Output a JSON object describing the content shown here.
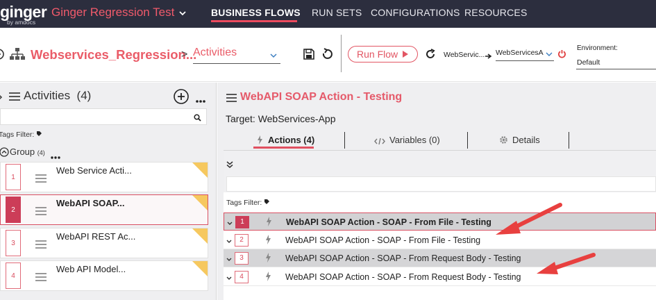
{
  "brand": {
    "logo": "ginger",
    "logo_sub": "by amdocs"
  },
  "app": {
    "solution_name": "Ginger Regression Test"
  },
  "nav": {
    "items": [
      "BUSINESS FLOWS",
      "RUN SETS",
      "CONFIGURATIONS",
      "RESOURCES"
    ],
    "active": "BUSINESS FLOWS"
  },
  "toolbar": {
    "business_flow_name": "Webservices_Regression...",
    "breadcrumb_separator": ">",
    "view_select": "Activities",
    "run_flow_label": "Run Flow",
    "target_app": "WebServic...",
    "target_agent": "WebServicesA",
    "environment_label": "Environment:",
    "environment_value": "Default"
  },
  "activities_panel": {
    "title": "Activities",
    "count": "(4)",
    "tags_filter_label": "Tags Filter:",
    "group_name": "Group",
    "group_count": "(4)",
    "items": [
      {
        "number": "1",
        "name": "Web Service Acti..."
      },
      {
        "number": "2",
        "name": "WebAPI SOAP..."
      },
      {
        "number": "3",
        "name": "WebAPI REST Ac..."
      },
      {
        "number": "4",
        "name": "Web API Model..."
      }
    ],
    "selected_index": 1
  },
  "activity_detail": {
    "title": "WebAPI SOAP Action - Testing",
    "target": "Target: WebServices-App",
    "tabs": [
      {
        "label": "Actions (4)",
        "active": true
      },
      {
        "label": "Variables (0)",
        "active": false
      },
      {
        "label": "Details",
        "active": false
      }
    ],
    "tags_filter_label": "Tags Filter:",
    "actions": [
      {
        "number": "1",
        "name": "WebAPI SOAP Action - SOAP - From File - Testing"
      },
      {
        "number": "2",
        "name": "WebAPI SOAP Action - SOAP - From File - Testing"
      },
      {
        "number": "3",
        "name": "WebAPI SOAP Action - SOAP - From Request Body - Testing"
      },
      {
        "number": "4",
        "name": "WebAPI SOAP Action - SOAP - From Request Body - Testing"
      }
    ],
    "selected_action_index": 0
  },
  "colors": {
    "accent": "#e05060",
    "topbar_bg": "#2c2e3e",
    "panel_bg": "#efeff1",
    "annotation_arrow": "#e8403f"
  },
  "icons": [
    "back-icon",
    "hierarchy-icon",
    "chevron-down-icon",
    "save-icon",
    "undo-icon",
    "play-icon",
    "refresh-icon",
    "arrow-right-icon",
    "power-icon",
    "list-icon",
    "add-icon",
    "more-icon",
    "search-icon",
    "tag-icon",
    "collapse-icon",
    "drag-handle-icon",
    "bolt-icon",
    "code-icon",
    "gear-icon",
    "expand-all-icon"
  ]
}
